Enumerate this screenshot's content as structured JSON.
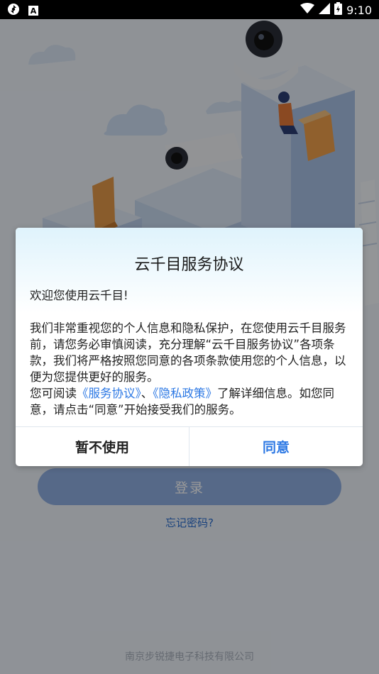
{
  "status_bar": {
    "time": "9:10",
    "left_icons": [
      "sync-icon",
      "a-box-icon"
    ],
    "right_icons": [
      "wifi-icon",
      "signal-icon",
      "battery-icon"
    ]
  },
  "login": {
    "login_button_label": "登录",
    "forgot_password_link": "忘记密码?",
    "company_name": "南京步锐捷电子科技有限公司"
  },
  "dialog": {
    "title": "云千目服务协议",
    "greeting": "欢迎您使用云千目!",
    "body_paragraph": "我们非常重视您的个人信息和隐私保护，在您使用云千目服务前，请您务必审慎阅读，充分理解“云千目服务协议”各项条款，我们将严格按照您同意的各项条款使用您的个人信息，以便为您提供更好的服务。",
    "read_prefix": "您可阅读",
    "service_agreement_link": "《服务协议》",
    "separator": "、",
    "privacy_policy_link": "《隐私政策》",
    "read_suffix": "了解详细信息。如您同意，请点击“同意”开始接受我们的服务。",
    "decline_button": "暂不使用",
    "agree_button": "同意"
  },
  "colors": {
    "accent": "#2c78e4",
    "login_button": "#8fb0e3",
    "overlay": "rgba(0,0,0,0.40)"
  }
}
